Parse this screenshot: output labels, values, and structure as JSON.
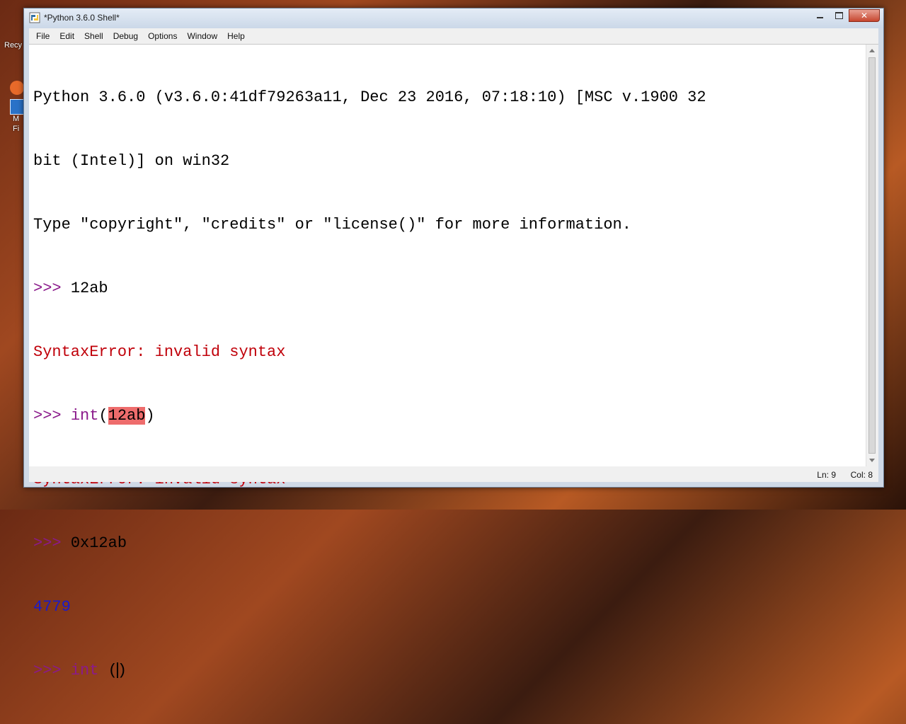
{
  "desktop": {
    "recycle_label": "Recy",
    "icon2_label_a": "M",
    "icon2_label_b": "Fi"
  },
  "window": {
    "title": "*Python 3.6.0 Shell*",
    "controls": {
      "minimize": "—",
      "maximize": "□",
      "close": "✕"
    }
  },
  "menu": {
    "items": [
      "File",
      "Edit",
      "Shell",
      "Debug",
      "Options",
      "Window",
      "Help"
    ]
  },
  "shell": {
    "banner_line1": "Python 3.6.0 (v3.6.0:41df79263a11, Dec 23 2016, 07:18:10) [MSC v.1900 32",
    "banner_line2": "bit (Intel)] on win32",
    "banner_line3": "Type \"copyright\", \"credits\" or \"license()\" for more information.",
    "prompt": ">>> ",
    "cmd1": "12ab",
    "error1": "SyntaxError: invalid syntax",
    "cmd2_func": "int",
    "cmd2_open": "(",
    "cmd2_arg": "12ab",
    "cmd2_close": ")",
    "error2": "SyntaxError: invalid syntax",
    "cmd3": "0x12ab",
    "output3": "4779",
    "cmd4_func": "int",
    "cmd4_open": " (",
    "cmd4_close": ")"
  },
  "status": {
    "line": "Ln: 9",
    "col": "Col: 8"
  },
  "colors": {
    "prompt": "#8b1a8b",
    "error": "#c0000a",
    "output": "#1a1acc",
    "highlight": "#ee6c6c"
  }
}
